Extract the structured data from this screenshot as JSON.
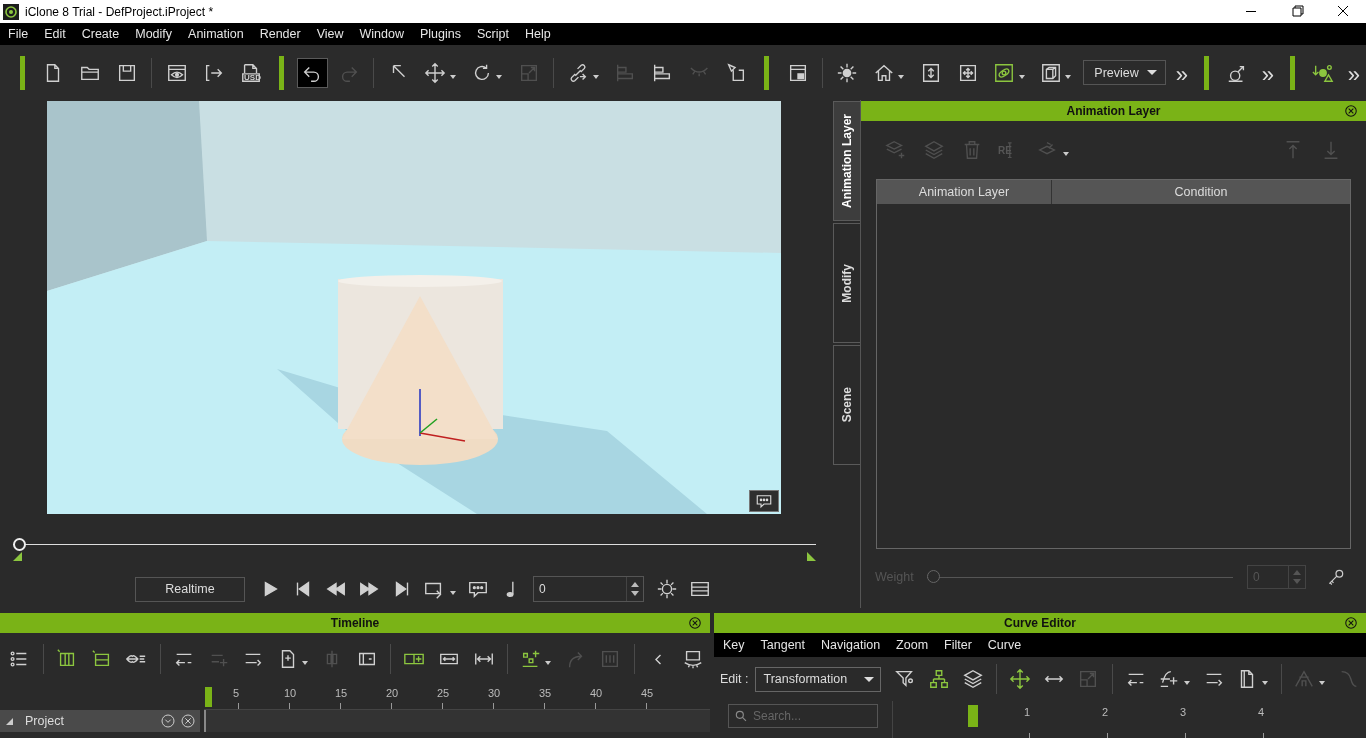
{
  "window": {
    "title": "iClone 8 Trial - DefProject.iProject *"
  },
  "menu": [
    "File",
    "Edit",
    "Create",
    "Modify",
    "Animation",
    "Render",
    "View",
    "Window",
    "Plugins",
    "Script",
    "Help"
  ],
  "main_toolbar": {
    "buttons": [
      {
        "disabled": false,
        "pressed": false
      },
      {
        "disabled": false,
        "pressed": false
      },
      {
        "disabled": false,
        "pressed": false
      },
      {
        "disabled": false,
        "pressed": false
      },
      {
        "disabled": false,
        "pressed": false
      },
      {
        "disabled": false,
        "pressed": false,
        "label": "USD"
      },
      {
        "disabled": false,
        "pressed": true
      },
      {
        "disabled": true,
        "pressed": false
      },
      {
        "disabled": false,
        "pressed": false
      },
      {
        "disabled": false,
        "pressed": false
      },
      {
        "disabled": false,
        "pressed": false
      },
      {
        "disabled": true,
        "pressed": false
      },
      {
        "disabled": false,
        "pressed": false
      },
      {
        "disabled": true,
        "pressed": false
      },
      {
        "disabled": false,
        "pressed": false
      },
      {
        "disabled": true,
        "pressed": false
      },
      {
        "disabled": false,
        "pressed": false
      },
      {
        "disabled": false,
        "pressed": false
      },
      {
        "disabled": false,
        "pressed": false
      },
      {
        "disabled": false,
        "pressed": false
      },
      {
        "disabled": false,
        "pressed": false
      },
      {
        "disabled": false,
        "pressed": false
      },
      {
        "disabled": false,
        "pressed": false
      },
      {
        "disabled": false,
        "pressed": false
      },
      {
        "disabled": false,
        "pressed": false
      },
      {
        "disabled": false,
        "pressed": false
      }
    ],
    "preview": "Preview",
    "more": [
      "»",
      "»",
      "»"
    ]
  },
  "viewport": {
    "scrubber": {
      "level": 0
    }
  },
  "playback": {
    "mode": "Realtime",
    "frame": "0"
  },
  "side_tabs": [
    {
      "label": "Animation Layer",
      "selected": true
    },
    {
      "label": "Modify",
      "selected": false
    },
    {
      "label": "Scene",
      "selected": false
    }
  ],
  "animation_layer": {
    "title": "Animation Layer",
    "buttons": [
      {
        "disabled": true
      },
      {
        "disabled": true
      },
      {
        "disabled": true
      },
      {
        "disabled": true,
        "label": "RE"
      },
      {
        "disabled": true
      },
      {
        "disabled": true
      },
      {
        "disabled": true
      }
    ],
    "columns": [
      "Animation Layer",
      "Condition"
    ],
    "weight": {
      "label": "Weight",
      "level": 0,
      "value": "0",
      "disabled": true
    }
  },
  "timeline": {
    "title": "Timeline",
    "buttons": [
      {
        "disabled": false
      },
      {
        "disabled": false
      },
      {
        "disabled": false
      },
      {
        "disabled": false
      },
      {
        "disabled": false
      },
      {
        "disabled": true
      },
      {
        "disabled": false
      },
      {
        "disabled": false
      },
      {
        "disabled": true
      },
      {
        "disabled": false
      },
      {
        "disabled": false
      },
      {
        "disabled": false
      },
      {
        "disabled": false
      },
      {
        "disabled": false
      },
      {
        "disabled": true
      },
      {
        "disabled": true
      },
      {
        "disabled": false
      },
      {
        "disabled": false
      }
    ],
    "ticks": [
      "5",
      "10",
      "15",
      "20",
      "25",
      "30",
      "35",
      "40",
      "45"
    ],
    "tracks": [
      {
        "name": "Project",
        "expanded": true
      }
    ]
  },
  "curve_editor": {
    "title": "Curve Editor",
    "menu": [
      "Key",
      "Tangent",
      "Navigation",
      "Zoom",
      "Filter",
      "Curve"
    ],
    "edit_label": "Edit :",
    "edit_value": "Transformation",
    "buttons": [
      {
        "disabled": false
      },
      {
        "disabled": false
      },
      {
        "disabled": false
      },
      {
        "disabled": false
      },
      {
        "disabled": false
      },
      {
        "disabled": true
      },
      {
        "disabled": false
      },
      {
        "disabled": false
      },
      {
        "disabled": false
      },
      {
        "disabled": false
      },
      {
        "disabled": true
      },
      {
        "disabled": true
      }
    ],
    "search": {
      "placeholder": "Search..."
    },
    "ticks": [
      "1",
      "2",
      "3",
      "4"
    ]
  }
}
